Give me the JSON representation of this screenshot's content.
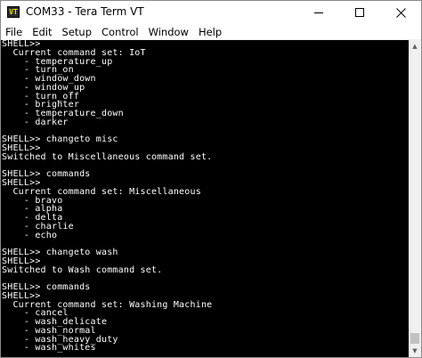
{
  "window": {
    "title": "COM33 - Tera Term VT",
    "icon_text": "VT"
  },
  "menu": [
    "File",
    "Edit",
    "Setup",
    "Control",
    "Window",
    "Help"
  ],
  "terminal": {
    "lines": [
      "SHELL>>",
      "  Current command set: IoT",
      "    - temperature_up",
      "    - turn_on",
      "    - window_down",
      "    - window_up",
      "    - turn_off",
      "    - brighter",
      "    - temperature_down",
      "    - darker",
      "",
      "SHELL>> changeto misc",
      "SHELL>>",
      "Switched to Miscellaneous command set.",
      "",
      "SHELL>> commands",
      "SHELL>>",
      "  Current command set: Miscellaneous",
      "    - bravo",
      "    - alpha",
      "    - delta",
      "    - charlie",
      "    - echo",
      "",
      "SHELL>> changeto wash",
      "SHELL>>",
      "Switched to Wash command set.",
      "",
      "SHELL>> commands",
      "SHELL>>",
      "  Current command set: Washing Machine",
      "    - cancel",
      "    - wash_delicate",
      "    - wash_normal",
      "    - wash_heavy_duty",
      "    - wash_whites"
    ]
  },
  "icons": {
    "app": "tera-term-icon",
    "minimize": "minimize-icon",
    "maximize": "maximize-icon",
    "close": "close-icon",
    "scroll_up": "scroll-up-arrow-icon",
    "scroll_down": "scroll-down-arrow-icon"
  },
  "colors": {
    "terminal_bg": "#000000",
    "terminal_fg": "#ffffff"
  }
}
